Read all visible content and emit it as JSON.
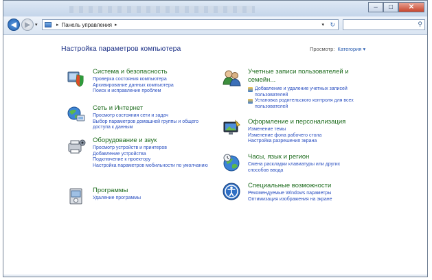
{
  "window": {
    "address_crumb": "Панель управления",
    "caption_icons": [
      "minimize-icon",
      "maximize-icon",
      "close-icon"
    ]
  },
  "header": {
    "title": "Настройка параметров компьютера",
    "view_by_label": "Просмотр:",
    "view_by_value": "Категория ▾"
  },
  "categories_left": [
    {
      "icon": "shield-icon",
      "title": "Система и безопасность",
      "links": [
        "Проверка состояния компьютера",
        "Архивирование данных компьютера",
        "Поиск и исправление проблем"
      ]
    },
    {
      "icon": "network-icon",
      "title": "Сеть и Интернет",
      "links": [
        "Просмотр состояния сети и задач",
        "Выбор параметров домашней группы и общего доступа к данным"
      ]
    },
    {
      "icon": "hardware-sound-icon",
      "title": "Оборудование и звук",
      "links": [
        "Просмотр устройств и принтеров",
        "Добавление устройства",
        "Подключение к проектору",
        "Настройка параметров мобильности по умолчанию"
      ]
    },
    {
      "icon": "programs-icon",
      "title": "Программы",
      "links": [
        "Удаление программы"
      ]
    }
  ],
  "categories_right": [
    {
      "icon": "user-accounts-icon",
      "title": "Учетные записи пользователей и семейн...",
      "links": [
        "Добавление и удаление учетных записей пользователей",
        "Установка родительского контроля для всех пользователей"
      ]
    },
    {
      "icon": "appearance-icon",
      "title": "Оформление и персонализация",
      "links": [
        "Изменение темы",
        "Изменение фона рабочего стола",
        "Настройка разрешения экрана"
      ]
    },
    {
      "icon": "clock-globe-icon",
      "title": "Часы, язык и регион",
      "links": [
        "Смена раскладки клавиатуры или других способов ввода"
      ]
    },
    {
      "icon": "accessibility-icon",
      "title": "Специальные возможности",
      "links": [
        "Рекомендуемые Windows параметры",
        "Оптимизация изображения на экране"
      ]
    }
  ],
  "colors": {
    "heading": "#1e3287",
    "category_title": "#1d6b1d",
    "link": "#2a4fc0"
  }
}
